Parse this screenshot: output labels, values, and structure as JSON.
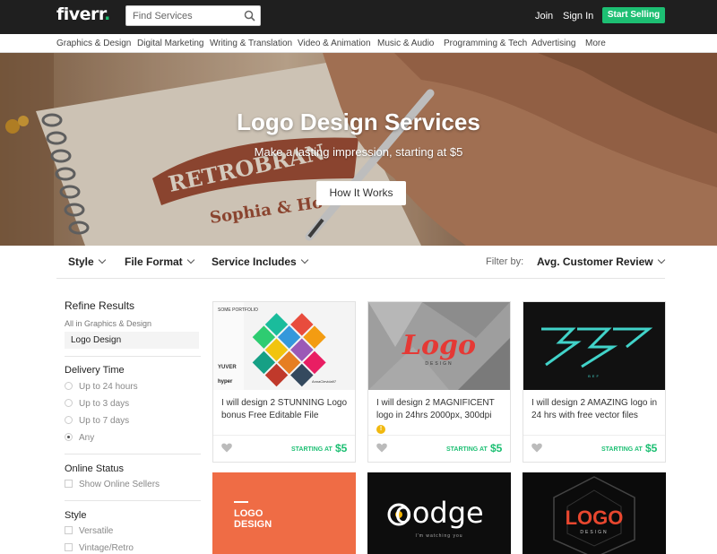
{
  "brand": {
    "logo_text": "fiverr",
    "accent": "#1dbf73"
  },
  "search": {
    "placeholder": "Find Services",
    "icon": "search-icon"
  },
  "header_links": {
    "join": "Join",
    "sign_in": "Sign In",
    "start_selling": "Start Selling"
  },
  "categories": [
    "Graphics & Design",
    "Digital Marketing",
    "Writing & Translation",
    "Video & Animation",
    "Music & Audio",
    "Programming & Tech",
    "Advertising",
    "More"
  ],
  "hero": {
    "title": "Logo Design Services",
    "subtitle": "Make a lasting impression, starting at $5",
    "button": "How It Works",
    "photo_text_1": "RETROBRAN",
    "photo_text_2": "Sophia & Ho"
  },
  "filters": {
    "style": "Style",
    "file_format": "File Format",
    "service_includes": "Service Includes",
    "filter_by_label": "Filter by:",
    "filter_by_value": "Avg. Customer Review"
  },
  "sidebar": {
    "refine_title": "Refine Results",
    "breadcrumb": "All in Graphics & Design",
    "selected_category": "Logo Design",
    "delivery_time": {
      "title": "Delivery Time",
      "options": [
        "Up to 24 hours",
        "Up to 3 days",
        "Up to 7 days",
        "Any"
      ],
      "selected": "Any"
    },
    "online_status": {
      "title": "Online Status",
      "option": "Show Online Sellers"
    },
    "style": {
      "title": "Style",
      "options": [
        "Versatile",
        "Vintage/Retro"
      ]
    }
  },
  "gigs": [
    {
      "title": "I will design 2 STUNNING Logo bonus Free Editable File",
      "starting_label": "STARTING AT",
      "price": "$5",
      "thumb_text": [
        "SOME PORTFOLIO",
        "YUVER",
        "hyper",
        "AnnaClevida97"
      ],
      "level_badge": ""
    },
    {
      "title": "I will design 2 MAGNIFICENT logo in 24hrs 2000px, 300dpi",
      "starting_label": "STARTING AT",
      "price": "$5",
      "thumb_text": [
        "Logo",
        "DESIGN"
      ],
      "level_badge": "!"
    },
    {
      "title": "I will design 2 AMAZING logo in 24 hrs with free vector files",
      "starting_label": "STARTING AT",
      "price": "$5",
      "thumb_text": [
        "BEF"
      ],
      "level_badge": ""
    }
  ],
  "gigs_row2": [
    {
      "thumb_text": [
        "LOGO",
        "DESIGN"
      ]
    },
    {
      "thumb_text": [
        "oodge",
        "I'm watching you"
      ]
    },
    {
      "thumb_text": [
        "LOGO",
        "DESIGN"
      ]
    }
  ]
}
